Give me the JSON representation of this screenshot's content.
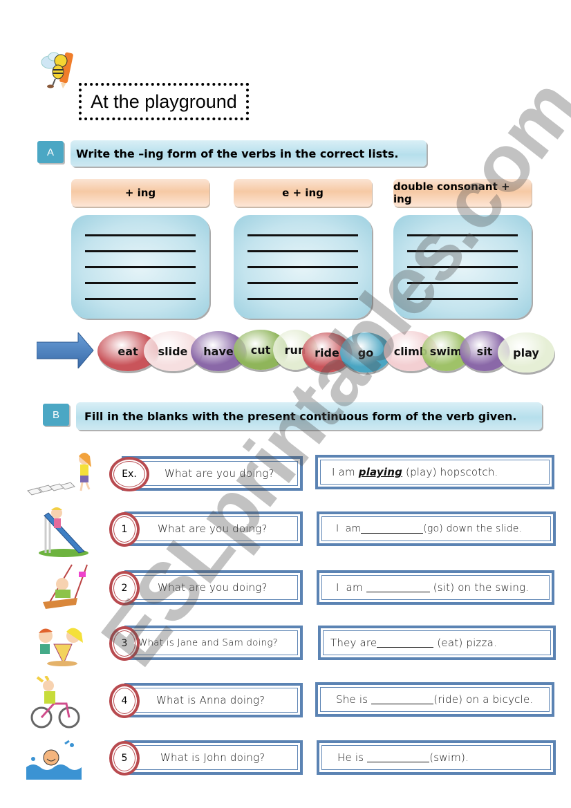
{
  "title": "At the playground",
  "section_a": {
    "letter": "A",
    "instruction": "Write the –ing form of the verbs in the correct lists.",
    "columns": [
      {
        "header": "+ ing",
        "lines": 5
      },
      {
        "header": "e + ing",
        "lines": 5
      },
      {
        "header": "double consonant + ing",
        "lines": 5
      }
    ],
    "verbs": [
      {
        "word": "eat",
        "color": "#c9545a"
      },
      {
        "word": "slide",
        "color": "#f6dfe0"
      },
      {
        "word": "have",
        "color": "#8a68a8"
      },
      {
        "word": "cut",
        "color": "#8fb55a"
      },
      {
        "word": "run",
        "color": "#e3ecd2"
      },
      {
        "word": "ride",
        "color": "#c9545a"
      },
      {
        "word": "go",
        "color": "#4aa5c2"
      },
      {
        "word": "climb",
        "color": "#f3cfd2"
      },
      {
        "word": "swim",
        "color": "#9fc268"
      },
      {
        "word": "sit",
        "color": "#8a68a8"
      },
      {
        "word": "play",
        "color": "#e6efd6"
      }
    ]
  },
  "section_b": {
    "letter": "B",
    "instruction": "Fill in the blanks with the present continuous form of the verb given.",
    "items": [
      {
        "number": "Ex.",
        "picture": "girl-hopscotch",
        "question": "What are you doing?",
        "answer_before": "I am ",
        "answer_filled": "playing",
        "answer_after": " (play) hopscotch."
      },
      {
        "number": "1",
        "picture": "girl-slide",
        "question": "What are you doing?",
        "answer_before": "I  am",
        "answer_filled": "",
        "answer_after": "(go) down the slide."
      },
      {
        "number": "2",
        "picture": "child-swing",
        "question": "What are you doing?",
        "answer_before": "I  am ",
        "answer_filled": "",
        "answer_after": " (sit) on the swing."
      },
      {
        "number": "3",
        "picture": "kids-eating-pizza",
        "question": "What is Jane and Sam doing?",
        "answer_before": "They are",
        "answer_filled": "",
        "answer_after": " (eat) pizza."
      },
      {
        "number": "4",
        "picture": "girl-bicycle",
        "question": "What is Anna doing?",
        "answer_before": "She is ",
        "answer_filled": "",
        "answer_after": "(ride) on a bicycle."
      },
      {
        "number": "5",
        "picture": "boy-swimming",
        "question": "What is John doing?",
        "answer_before": "He is ",
        "answer_filled": "",
        "answer_after": "(swim)."
      }
    ]
  },
  "watermark": "ESLprintables.com",
  "colors": {
    "section_letter": "#4ba7c4",
    "frame_blue": "#5b83b3",
    "circle_red": "#b84a4f",
    "arrow_blue": "#4a7fc1"
  }
}
